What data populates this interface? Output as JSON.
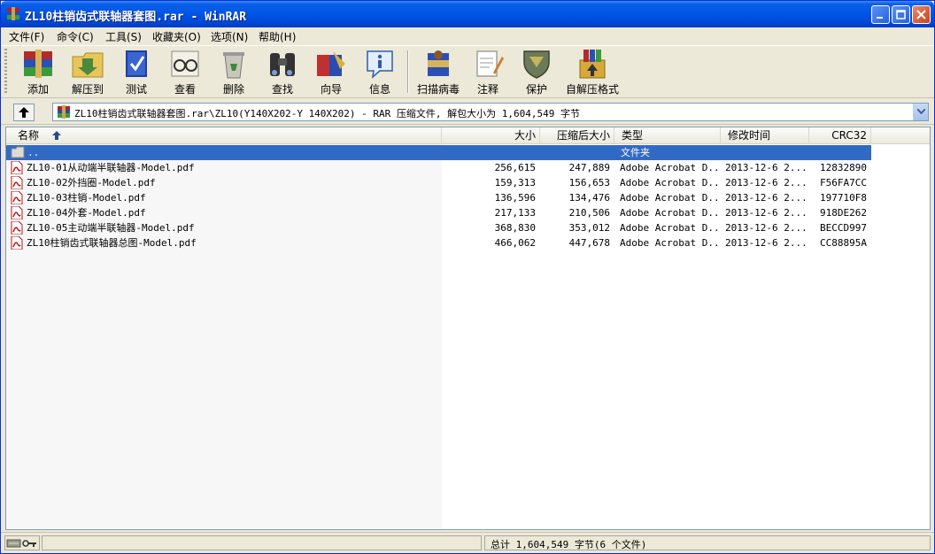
{
  "window": {
    "title": "ZL10柱销齿式联轴器套图.rar - WinRAR"
  },
  "menu": [
    {
      "label": "文件(F)"
    },
    {
      "label": "命令(C)"
    },
    {
      "label": "工具(S)"
    },
    {
      "label": "收藏夹(O)"
    },
    {
      "label": "选项(N)"
    },
    {
      "label": "帮助(H)"
    }
  ],
  "toolbar": [
    {
      "label": "添加",
      "icon": "books-add-icon"
    },
    {
      "label": "解压到",
      "icon": "folder-extract-icon"
    },
    {
      "label": "测试",
      "icon": "book-test-icon"
    },
    {
      "label": "查看",
      "icon": "glasses-view-icon"
    },
    {
      "label": "删除",
      "icon": "recycle-bin-icon"
    },
    {
      "label": "查找",
      "icon": "binoculars-icon"
    },
    {
      "label": "向导",
      "icon": "wizard-icon"
    },
    {
      "label": "信息",
      "icon": "info-icon"
    },
    {
      "label": "扫描病毒",
      "icon": "virus-scan-icon"
    },
    {
      "label": "注释",
      "icon": "comment-icon"
    },
    {
      "label": "保护",
      "icon": "shield-icon"
    },
    {
      "label": "自解压格式",
      "icon": "sfx-box-icon"
    }
  ],
  "address": {
    "text": "ZL10柱销齿式联轴器套图.rar\\ZL10(Y140X202-Y 140X202) - RAR 压缩文件, 解包大小为 1,604,549 字节"
  },
  "columns": {
    "name": "名称",
    "size": "大小",
    "packed": "压缩后大小",
    "type": "类型",
    "modified": "修改时间",
    "crc": "CRC32"
  },
  "parent_row": {
    "name": "..",
    "type": "文件夹"
  },
  "files": [
    {
      "name": "ZL10-01从动端半联轴器-Model.pdf",
      "size": "256,615",
      "packed": "247,889",
      "type": "Adobe Acrobat D...",
      "modified": "2013-12-6 2...",
      "crc": "12832890"
    },
    {
      "name": "ZL10-02外挡圈-Model.pdf",
      "size": "159,313",
      "packed": "156,653",
      "type": "Adobe Acrobat D...",
      "modified": "2013-12-6 2...",
      "crc": "F56FA7CC"
    },
    {
      "name": "ZL10-03柱销-Model.pdf",
      "size": "136,596",
      "packed": "134,476",
      "type": "Adobe Acrobat D...",
      "modified": "2013-12-6 2...",
      "crc": "197710F8"
    },
    {
      "name": "ZL10-04外套-Model.pdf",
      "size": "217,133",
      "packed": "210,506",
      "type": "Adobe Acrobat D...",
      "modified": "2013-12-6 2...",
      "crc": "918DE262"
    },
    {
      "name": "ZL10-05主动端半联轴器-Model.pdf",
      "size": "368,830",
      "packed": "353,012",
      "type": "Adobe Acrobat D...",
      "modified": "2013-12-6 2...",
      "crc": "BECCD997"
    },
    {
      "name": "ZL10柱销齿式联轴器总图-Model.pdf",
      "size": "466,062",
      "packed": "447,678",
      "type": "Adobe Acrobat D...",
      "modified": "2013-12-6 2...",
      "crc": "CC88895A"
    }
  ],
  "status": {
    "total": "总计 1,604,549 字节(6 个文件)"
  },
  "colors": {
    "selection": "#316ac5",
    "titlebar": "#0055e5",
    "face": "#ece9d8"
  }
}
